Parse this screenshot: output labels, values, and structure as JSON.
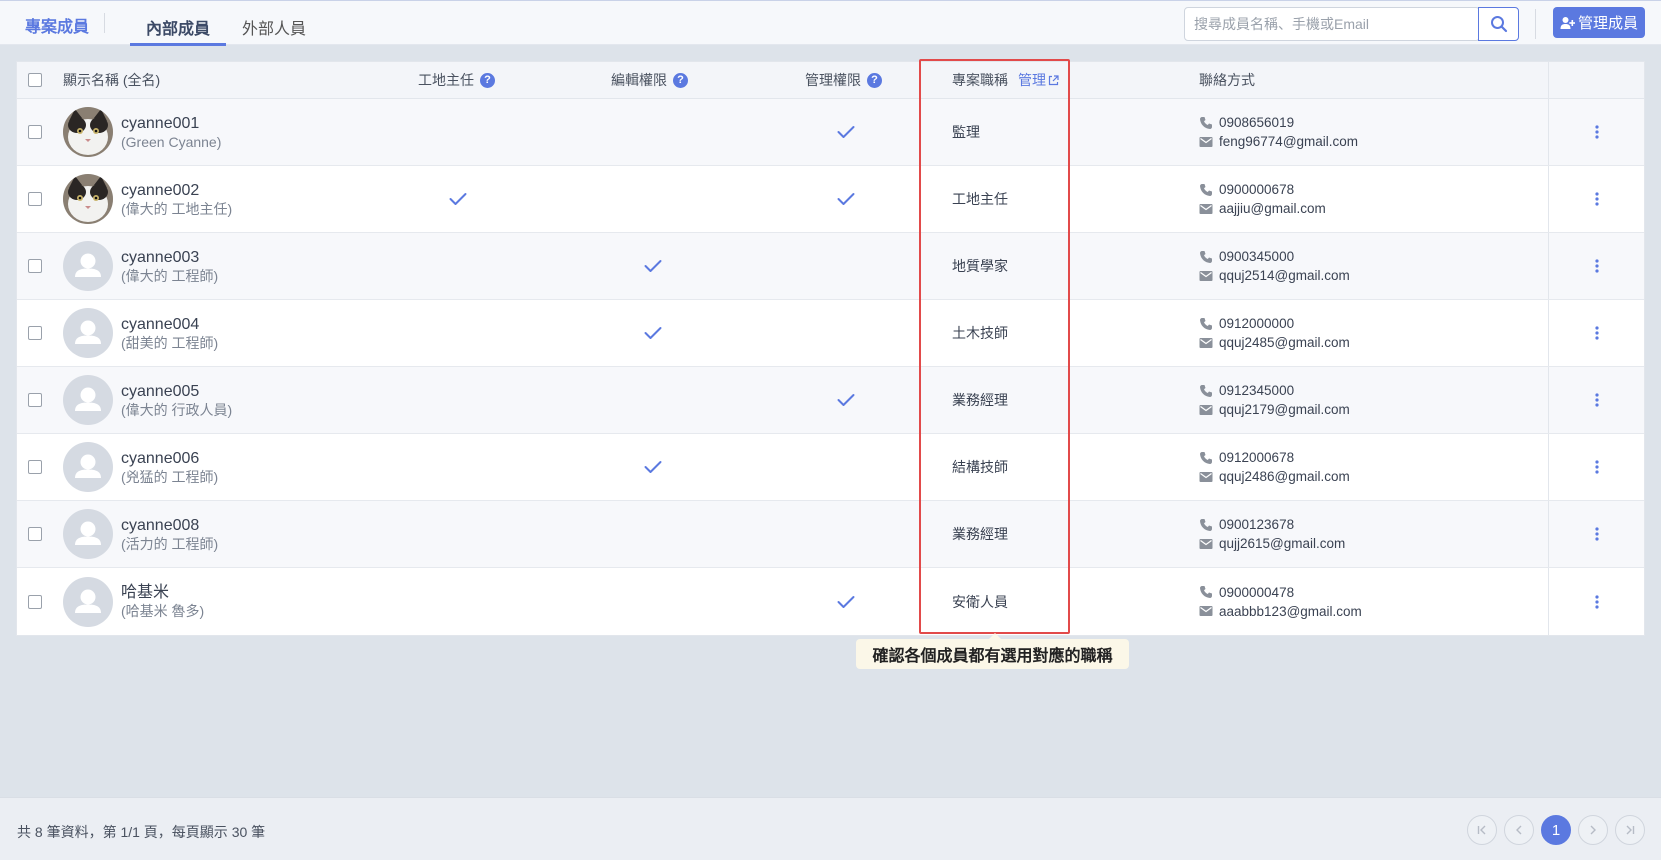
{
  "topbar": {
    "brand": "專案成員",
    "tabs": [
      {
        "label": "內部成員",
        "active": true
      },
      {
        "label": "外部人員",
        "active": false
      }
    ],
    "search_placeholder": "搜尋成員名稱、手機或Email",
    "manage_button": "管理成員"
  },
  "table": {
    "columns": {
      "name": "顯示名稱 (全名)",
      "site_supervisor": "工地主任",
      "edit_permission": "編輯權限",
      "admin_permission": "管理權限",
      "job_title": "專案職稱",
      "job_title_manage": "管理",
      "contact": "聯絡方式"
    },
    "rows": [
      {
        "username": "cyanne001",
        "fullname": "(Green Cyanne)",
        "avatar": "photo-cat",
        "site_supervisor": false,
        "edit": false,
        "admin": true,
        "role": "監理",
        "phone": "0908656019",
        "email": "feng96774@gmail.com"
      },
      {
        "username": "cyanne002",
        "fullname": "(偉大的 工地主任)",
        "avatar": "photo-cat",
        "site_supervisor": true,
        "edit": false,
        "admin": true,
        "role": "工地主任",
        "phone": "0900000678",
        "email": "aajjiu@gmail.com"
      },
      {
        "username": "cyanne003",
        "fullname": "(偉大的 工程師)",
        "avatar": "default",
        "site_supervisor": false,
        "edit": true,
        "admin": false,
        "role": "地質學家",
        "phone": "0900345000",
        "email": "qquj2514@gmail.com"
      },
      {
        "username": "cyanne004",
        "fullname": "(甜美的 工程師)",
        "avatar": "default",
        "site_supervisor": false,
        "edit": true,
        "admin": false,
        "role": "土木技師",
        "phone": "0912000000",
        "email": "qquj2485@gmail.com"
      },
      {
        "username": "cyanne005",
        "fullname": "(偉大的 行政人員)",
        "avatar": "default",
        "site_supervisor": false,
        "edit": false,
        "admin": true,
        "role": "業務經理",
        "phone": "0912345000",
        "email": "qquj2179@gmail.com"
      },
      {
        "username": "cyanne006",
        "fullname": "(兇猛的 工程師)",
        "avatar": "default",
        "site_supervisor": false,
        "edit": true,
        "admin": false,
        "role": "結構技師",
        "phone": "0912000678",
        "email": "qquj2486@gmail.com"
      },
      {
        "username": "cyanne008",
        "fullname": "(活力的 工程師)",
        "avatar": "default",
        "site_supervisor": false,
        "edit": false,
        "admin": false,
        "role": "業務經理",
        "phone": "0900123678",
        "email": "qujj2615@gmail.com"
      },
      {
        "username": "哈基米",
        "fullname": "(哈基米 魯多)",
        "avatar": "default",
        "site_supervisor": false,
        "edit": false,
        "admin": true,
        "role": "安衛人員",
        "phone": "0900000478",
        "email": "aaabbb123@gmail.com"
      }
    ]
  },
  "callout": "確認各個成員都有選用對應的職稱",
  "footer": {
    "summary": "共 8 筆資料，第 1/1 頁，每頁顯示 30 筆",
    "current_page": "1"
  },
  "colors": {
    "accent": "#5b79e0",
    "highlight": "#e24a4a"
  },
  "icons": [
    "search-icon",
    "add-user-icon",
    "help-icon",
    "external-link-icon",
    "check-icon",
    "phone-icon",
    "mail-icon",
    "kebab-menu-icon",
    "first-page-icon",
    "prev-page-icon",
    "next-page-icon",
    "last-page-icon"
  ]
}
